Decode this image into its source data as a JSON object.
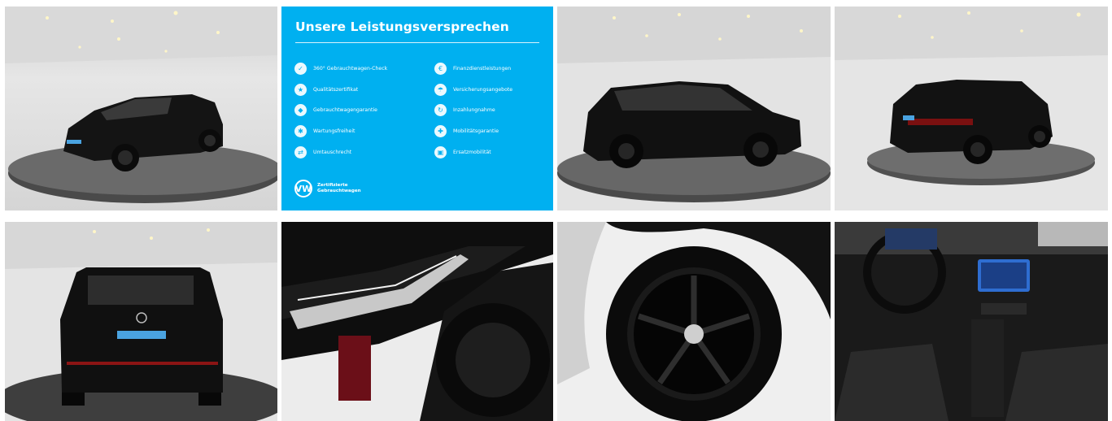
{
  "gallery": {
    "photos": [
      {
        "name": "photo-front-left-showroom",
        "index": 1
      },
      {
        "name": "promo-card",
        "index": 2
      },
      {
        "name": "photo-side-showroom",
        "index": 3
      },
      {
        "name": "photo-rear-left-showroom",
        "index": 4
      },
      {
        "name": "photo-rear-showroom",
        "index": 5
      },
      {
        "name": "photo-headlight-closeup",
        "index": 6
      },
      {
        "name": "photo-wheel-closeup",
        "index": 7
      },
      {
        "name": "photo-cockpit-interior",
        "index": 8
      }
    ]
  },
  "promo": {
    "title": "Unsere Leistungsversprechen",
    "benefits": [
      {
        "label": "360° Gebrauchtwagen-Check",
        "icon": "360-check-icon"
      },
      {
        "label": "Qualitätszertifikat",
        "icon": "certificate-icon"
      },
      {
        "label": "Gebrauchtwagengarantie",
        "icon": "shield-icon"
      },
      {
        "label": "Wartungsfreiheit",
        "icon": "wrench-icon"
      },
      {
        "label": "Umtauschrecht",
        "icon": "exchange-icon"
      },
      {
        "label": "Finanzdienstleistungen",
        "icon": "finance-icon"
      },
      {
        "label": "Versicherungsangebote",
        "icon": "insurance-icon"
      },
      {
        "label": "Inzahlungnahme",
        "icon": "trade-in-icon"
      },
      {
        "label": "Mobilitätsgarantie",
        "icon": "mobility-icon"
      },
      {
        "label": "Ersatzmobilität",
        "icon": "replacement-car-icon"
      }
    ],
    "footer_line1": "Zertifizierte",
    "footer_line2": "Gebrauchtwagen",
    "logo_text": "VW",
    "colors": {
      "background": "#00b0f0",
      "text": "#ffffff"
    }
  }
}
